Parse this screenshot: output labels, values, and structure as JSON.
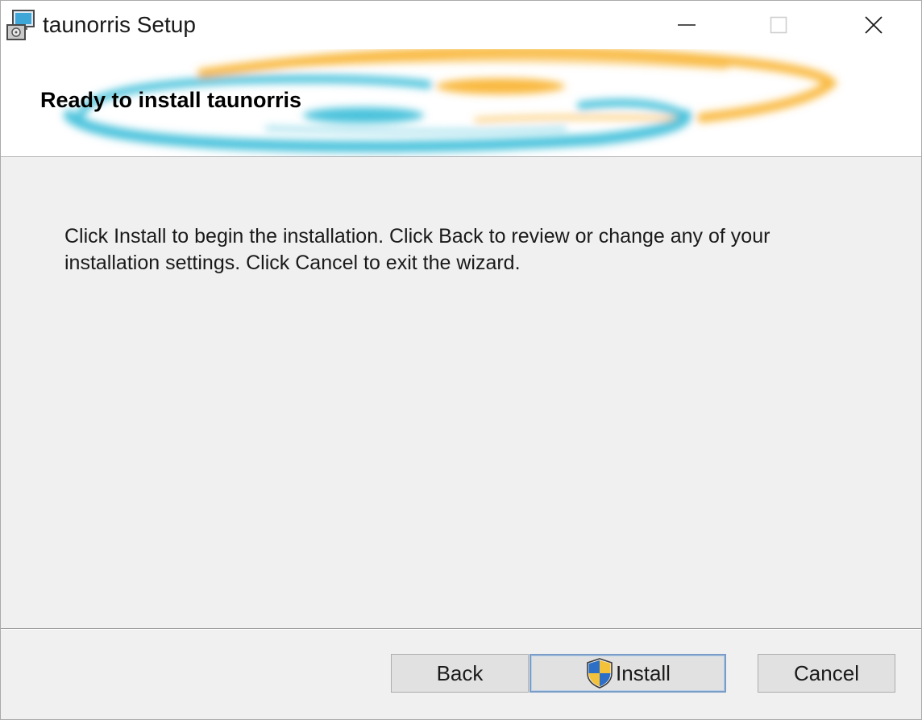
{
  "window": {
    "title": "taunorris Setup",
    "icons": {
      "app": "installer-icon",
      "minimize": "minimize-icon",
      "maximize": "maximize-icon",
      "close": "close-icon"
    }
  },
  "banner": {
    "title": "Ready to install taunorris",
    "accent_colors": {
      "orange": "#f9b941",
      "cyan": "#4cc3dc"
    }
  },
  "body": {
    "text": "Click Install to begin the installation. Click Back to review or change any of your installation settings. Click Cancel to exit the wizard."
  },
  "buttons": {
    "back": "Back",
    "install": "Install",
    "cancel": "Cancel",
    "install_icon": "uac-shield-icon"
  }
}
